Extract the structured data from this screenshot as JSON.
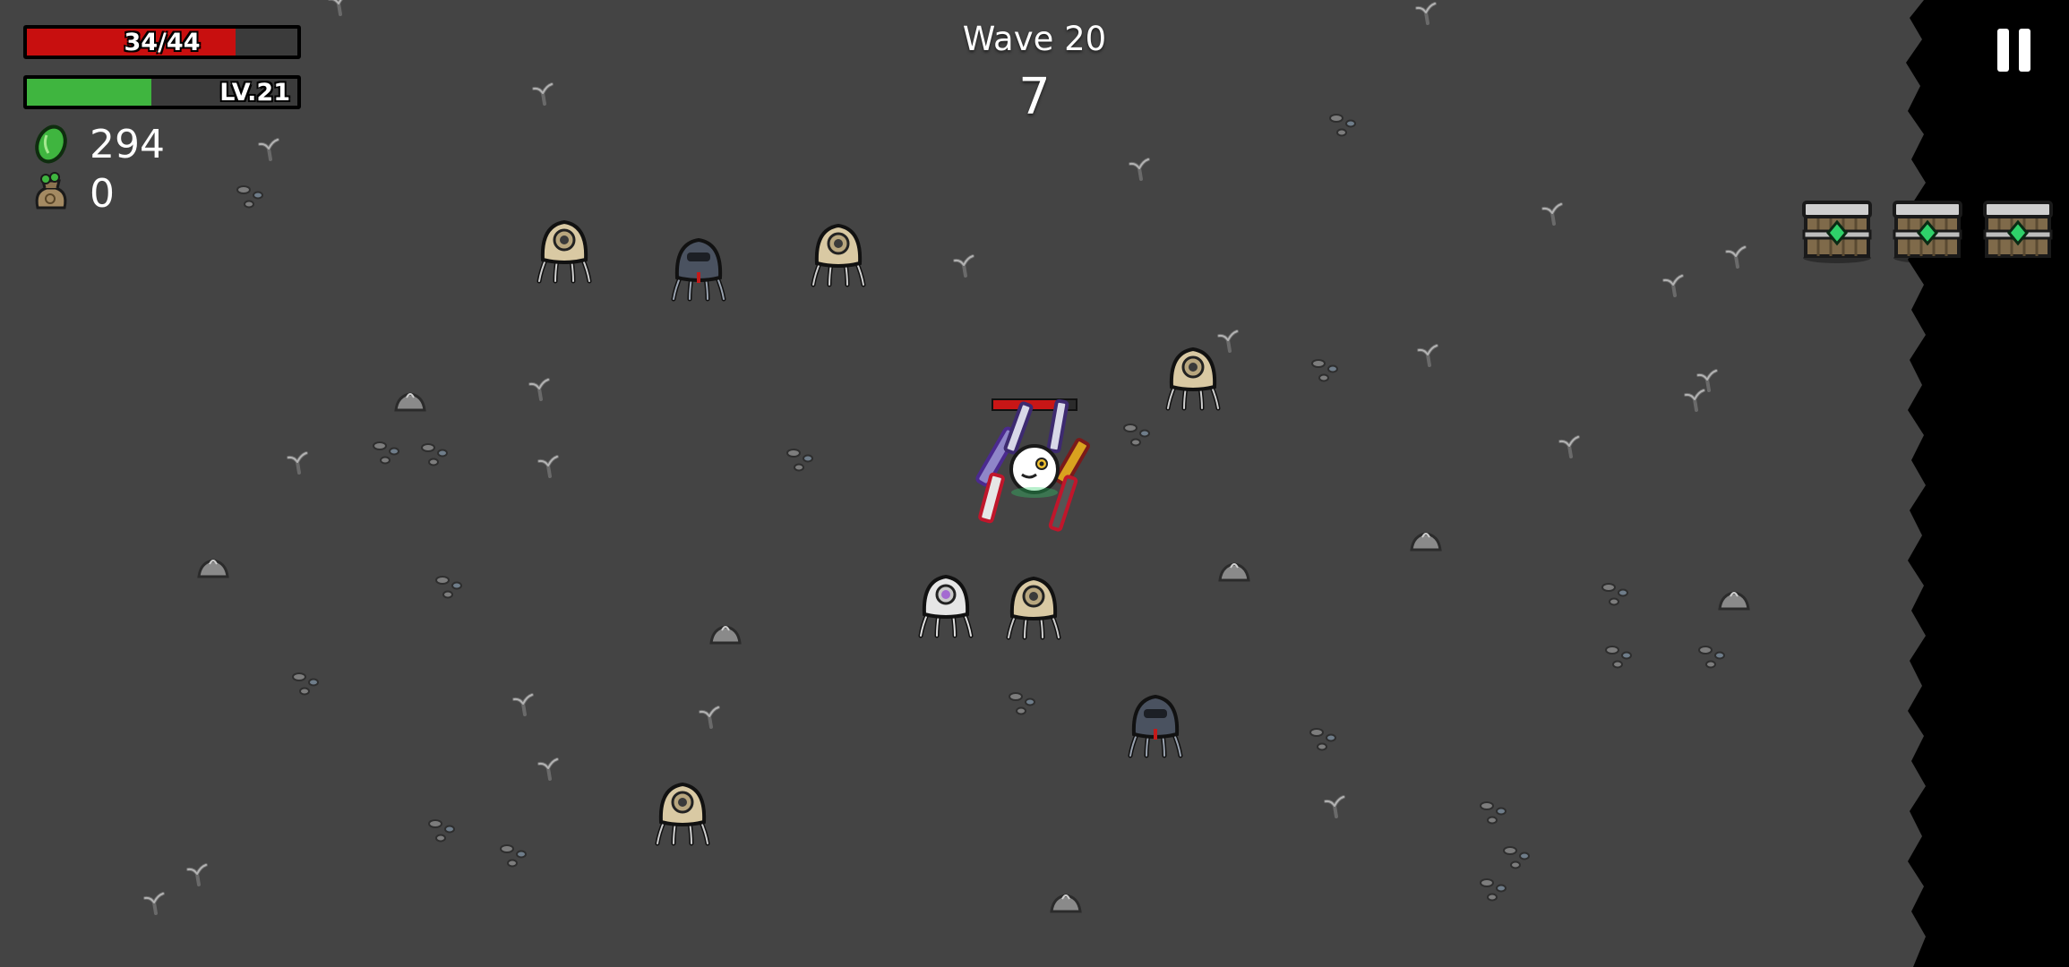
{
  "hud": {
    "hp": {
      "label": "34/44",
      "fraction": 0.773,
      "color": "#c80f0f"
    },
    "xp": {
      "label": "LV.21",
      "fraction": 0.46,
      "color": "#3fb53f"
    },
    "materials": {
      "value": "294",
      "icon": "green-material-icon"
    },
    "bag": {
      "value": "0",
      "icon": "money-bag-icon"
    }
  },
  "wave": {
    "title": "Wave 20",
    "timer": "7"
  },
  "pause": {
    "icon": "pause-icon"
  },
  "pickups": [
    {
      "type": "loot-crate",
      "icon": "crate-icon"
    },
    {
      "type": "loot-crate",
      "icon": "crate-icon"
    },
    {
      "type": "loot-crate",
      "icon": "crate-icon"
    }
  ],
  "player": {
    "health_fraction": 0.78,
    "weapons": 6
  },
  "enemies": [
    {
      "kind": "tan"
    },
    {
      "kind": "dark"
    },
    {
      "kind": "tan"
    },
    {
      "kind": "tan"
    },
    {
      "kind": "white"
    },
    {
      "kind": "tan"
    },
    {
      "kind": "dark"
    },
    {
      "kind": "tan"
    }
  ],
  "colors": {
    "ground": "#444444",
    "void": "#000000",
    "accent_green": "#2fd16a"
  }
}
